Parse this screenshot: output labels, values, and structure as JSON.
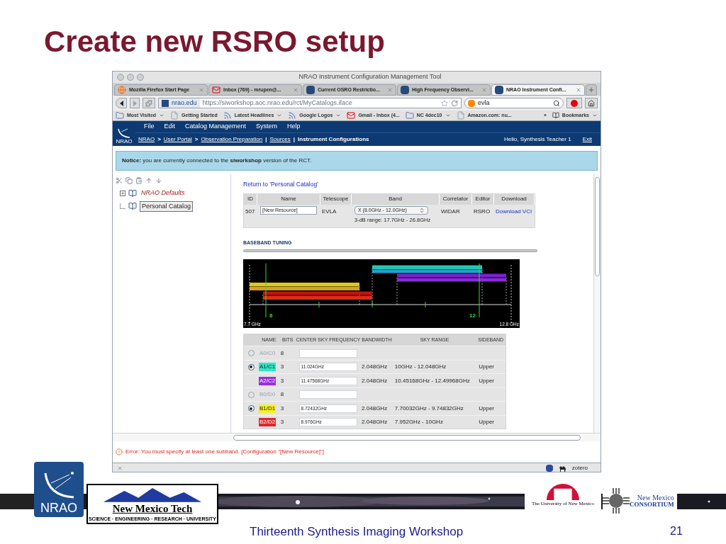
{
  "slide": {
    "title": "Create new RSRO setup",
    "footer": "Thirteenth Synthesis Imaging Workshop",
    "page_number": "21"
  },
  "logos": {
    "nrao": "NRAO",
    "nmt_name": "New Mexico Tech",
    "nmt_tagline": "SCIENCE · ENGINEERING · RESEARCH · UNIVERSITY",
    "unm": "The University of New Mexico",
    "nmc_top": "New Mexico",
    "nmc_bottom": "CONSORTIUM"
  },
  "browser": {
    "title": "NRAO Instrument Configuration Management Tool",
    "tabs": [
      {
        "label": "Mozilla Firefox Start Page",
        "kind": "firefox",
        "selected": false
      },
      {
        "label": "Inbox (769) - mrupen@...",
        "kind": "mail",
        "selected": false
      },
      {
        "label": "Current OSRO Restrictio...",
        "kind": "nrao",
        "selected": false
      },
      {
        "label": "High Frequency Observi...",
        "kind": "nrao",
        "selected": false
      },
      {
        "label": "NRAO Instrument Confi...",
        "kind": "nrao",
        "selected": true
      }
    ],
    "url_domain": "nrao.edu",
    "url": "https://siworkshop.aoc.nrao.edu/rct/MyCatalogs.iface",
    "search": "evla",
    "bookmarks": [
      {
        "label": "Most Visited",
        "kind": "folder",
        "menu": true
      },
      {
        "label": "Getting Started",
        "kind": "page",
        "menu": false
      },
      {
        "label": "Latest Headlines",
        "kind": "feed",
        "menu": true
      },
      {
        "label": "Google Logos",
        "kind": "feed",
        "menu": true
      },
      {
        "label": "Gmail - Inbox (4...",
        "kind": "mail",
        "menu": false
      },
      {
        "label": "NC 4dec10",
        "kind": "folder",
        "menu": true
      },
      {
        "label": "Amazon.com: nu...",
        "kind": "page",
        "menu": false
      }
    ],
    "overflow": "»",
    "bookmarks_menu": "Bookmarks",
    "status_text": "zotero"
  },
  "app": {
    "logo": "NRAO",
    "menu": [
      "File",
      "Edit",
      "Catalog Management",
      "System",
      "Help"
    ],
    "breadcrumb": [
      {
        "label": "NRAO",
        "link": true
      },
      {
        "label": ">",
        "link": false
      },
      {
        "label": "User Portal",
        "link": true
      },
      {
        "label": ">",
        "link": false
      },
      {
        "label": "Observation Preparation",
        "link": true
      },
      {
        "label": "|",
        "link": false
      },
      {
        "label": "Sources",
        "link": true
      },
      {
        "label": "|",
        "link": false
      },
      {
        "label": "Instrument Configurations",
        "link": false
      }
    ],
    "greeting": "Hello, Synthesis Teacher 1",
    "exit": "Exit",
    "notice": "**Notice:** you are currently connected to the **siworkshop** version of the RCT.",
    "tree": [
      {
        "label": "NRAO Defaults",
        "expanded": false,
        "selected": false,
        "kind": "defaults"
      },
      {
        "label": "Personal Catalog",
        "selected": true,
        "kind": "personal"
      }
    ],
    "return_link": "Return to 'Personal Catalog'",
    "config_table": {
      "columns": [
        "ID",
        "Name",
        "Telescope",
        "Band",
        "Correlator",
        "Editor",
        "Download"
      ],
      "row": {
        "id": "507",
        "name": "[New Resource]",
        "telescope": "EVLA",
        "band": "X (8.0GHz - 12.0GHz)",
        "band_note": "3-dB range: 17.7GHz - 26.8GHz",
        "correlator": "WIDAR",
        "editor": "RSRO",
        "download": "Download VCI"
      }
    },
    "section_title": "BASEBAND TUNING",
    "chart": {
      "left_label": "7.7 GHz",
      "right_label": "12.8 GHz",
      "ticks": [
        "8",
        "12"
      ]
    },
    "subbands": {
      "columns": [
        "NAME",
        "BITS",
        "CENTER SKY FREQUENCY",
        "BANDWIDTH",
        "SKY RANGE",
        "SIDEBAND"
      ],
      "rows": [
        {
          "kind": "radio",
          "selected": false,
          "disabled": true,
          "name": "A0/C0",
          "bits": "8"
        },
        {
          "kind": "radio",
          "selected": true,
          "disabled": false,
          "name": "A1/C1",
          "color": "#2ee8c8",
          "bits": "3",
          "frequency": "11.024GHz",
          "bandwidth": "2.048GHz",
          "sky_range": "10GHz - 12.048GHz",
          "sideband": "Upper"
        },
        {
          "kind": "plain",
          "disabled": false,
          "name": "A2/C2",
          "color": "#9a2ee0",
          "bits": "3",
          "frequency": "11.47568GHz",
          "bandwidth": "2.048GHz",
          "sky_range": "10.45168GHz - 12.49968GHz",
          "sideband": "Upper"
        },
        {
          "kind": "radio",
          "selected": false,
          "disabled": true,
          "name": "B0/D0",
          "bits": "8"
        },
        {
          "kind": "radio",
          "selected": true,
          "disabled": false,
          "name": "B1/D1",
          "color": "#f4f020",
          "bits": "3",
          "frequency": "8.72432GHz",
          "bandwidth": "2.048GHz",
          "sky_range": "7.70032GHz - 9.74832GHz",
          "sideband": "Upper"
        },
        {
          "kind": "plain",
          "disabled": false,
          "name": "B2/D2",
          "color": "#e02828",
          "bits": "3",
          "frequency": "8.976GHz",
          "bandwidth": "2.048GHz",
          "sky_range": "7.952GHz - 10GHz",
          "sideband": "Upper"
        }
      ]
    },
    "error": "Error: You must specify at least one subband. [Configuration \"[New Resource]\"]"
  }
}
